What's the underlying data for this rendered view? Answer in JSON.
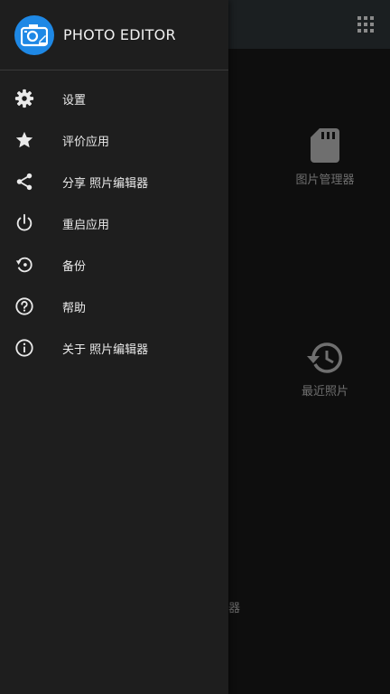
{
  "app": {
    "title": "PHOTO EDITOR"
  },
  "drawer": {
    "items": [
      {
        "label": "设置",
        "icon": "gear-icon"
      },
      {
        "label": "评价应用",
        "icon": "star-icon"
      },
      {
        "label": "分享 照片编辑器",
        "icon": "share-icon"
      },
      {
        "label": "重启应用",
        "icon": "power-icon"
      },
      {
        "label": "备份",
        "icon": "backup-icon"
      },
      {
        "label": "帮助",
        "icon": "help-icon"
      },
      {
        "label": "关于 照片编辑器",
        "icon": "info-icon"
      }
    ]
  },
  "background": {
    "tiles": [
      {
        "label": "图片管理器",
        "icon": "sd-card-icon"
      },
      {
        "label": "最近照片",
        "icon": "history-icon"
      }
    ],
    "fragment": "器"
  },
  "colors": {
    "drawer_bg": "#1e1e1e",
    "logo_accent": "#1e88e5",
    "icon_color": "#eaeaea"
  }
}
